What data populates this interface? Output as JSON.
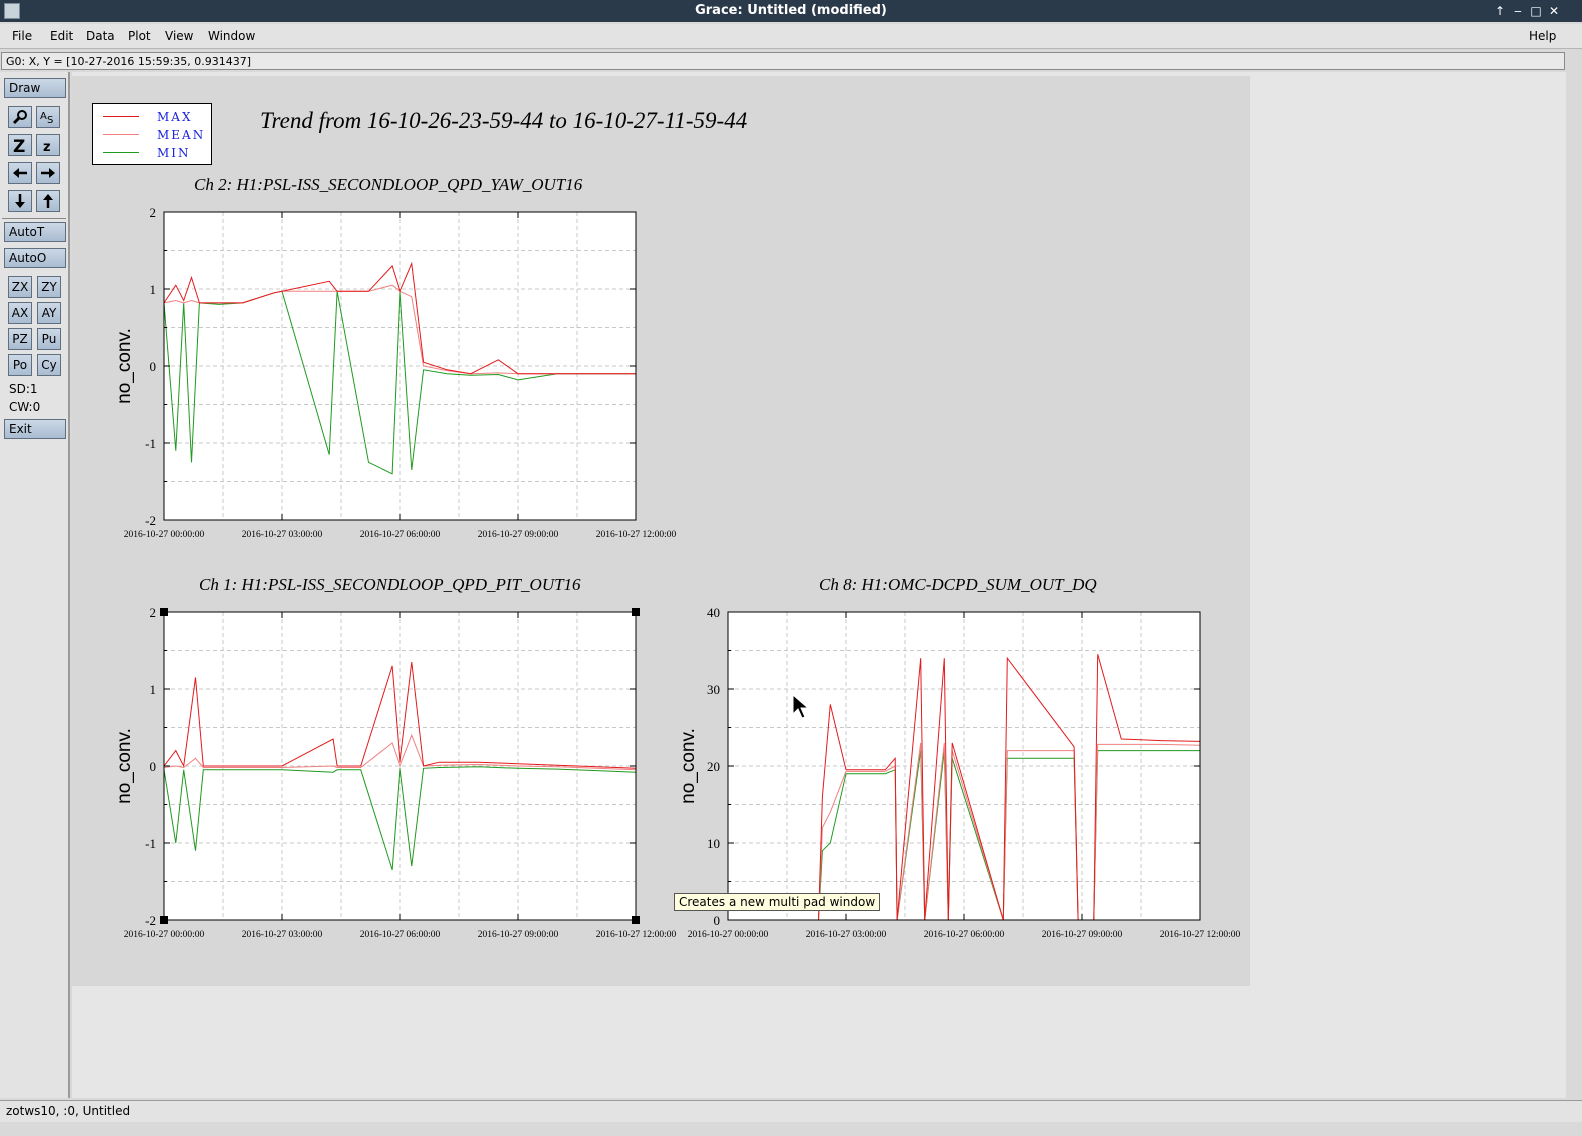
{
  "window": {
    "title": "Grace: Untitled (modified)"
  },
  "menu": {
    "items": [
      "File",
      "Edit",
      "Data",
      "Plot",
      "View",
      "Window"
    ],
    "help": "Help"
  },
  "locator": "G0: X, Y = [10-27-2016 15:59:35, 0.931437]",
  "toolbar": {
    "draw": "Draw",
    "autot": "AutoT",
    "autoo": "AutoO",
    "zx": "ZX",
    "zy": "ZY",
    "ax": "AX",
    "ay": "AY",
    "pz": "PZ",
    "pu": "Pu",
    "po": "Po",
    "cy": "Cy",
    "sd": "SD:1",
    "cw": "CW:0",
    "exit": "Exit"
  },
  "status": "zotws10, :0, Untitled",
  "tooltip": "Creates a new multi pad window",
  "legend": [
    {
      "label": "MAX",
      "color": "#e31a1c"
    },
    {
      "label": "MEAN",
      "color": "#f08080"
    },
    {
      "label": "MIN",
      "color": "#1f9a1f"
    }
  ],
  "plot_title": "Trend from 16-10-26-23-59-44 to 16-10-27-11-59-44",
  "chart_data": [
    {
      "type": "line",
      "title": "Ch 2: H1:PSL-ISS_SECONDLOOP_QPD_YAW_OUT16",
      "ylabel": "no_conv.",
      "ylim": [
        -2,
        2
      ],
      "yticks": [
        "2",
        "1",
        "0",
        "-1",
        "-2"
      ],
      "xticks": [
        "2016-10-27 00:00:00",
        "2016-10-27 03:00:00",
        "2016-10-27 06:00:00",
        "2016-10-27 09:00:00",
        "2016-10-27 12:00:00"
      ],
      "grid": true,
      "x_hours": [
        0,
        0.3,
        0.5,
        0.7,
        0.9,
        1.4,
        2.0,
        2.8,
        3.0,
        4.2,
        4.4,
        5.2,
        5.8,
        6.0,
        6.3,
        6.6,
        7.2,
        7.8,
        8.5,
        9.0,
        10.0,
        11.0,
        12.0
      ],
      "series": [
        {
          "name": "MAX",
          "values": [
            0.82,
            1.05,
            0.85,
            1.15,
            0.82,
            0.82,
            0.82,
            0.95,
            0.97,
            1.1,
            0.97,
            0.97,
            1.3,
            0.97,
            1.33,
            0.05,
            -0.05,
            -0.1,
            0.08,
            -0.1,
            -0.1,
            -0.1,
            -0.1
          ]
        },
        {
          "name": "MEAN",
          "values": [
            0.82,
            0.85,
            0.82,
            0.85,
            0.82,
            0.82,
            0.82,
            0.95,
            0.97,
            0.97,
            0.97,
            0.97,
            1.05,
            0.97,
            0.9,
            0.0,
            -0.06,
            -0.1,
            -0.09,
            -0.1,
            -0.1,
            -0.1,
            -0.1
          ]
        },
        {
          "name": "MIN",
          "values": [
            0.82,
            -1.1,
            0.82,
            -1.25,
            0.82,
            0.8,
            0.82,
            0.95,
            0.97,
            -1.15,
            0.97,
            -1.25,
            -1.4,
            0.97,
            -1.35,
            -0.05,
            -0.1,
            -0.12,
            -0.11,
            -0.18,
            -0.1,
            -0.1,
            -0.1
          ]
        }
      ]
    },
    {
      "type": "line",
      "title": "Ch 1: H1:PSL-ISS_SECONDLOOP_QPD_PIT_OUT16",
      "ylabel": "no_conv.",
      "ylim": [
        -2,
        2
      ],
      "yticks": [
        "2",
        "1",
        "0",
        "-1",
        "-2"
      ],
      "xticks": [
        "2016-10-27 00:00:00",
        "2016-10-27 03:00:00",
        "2016-10-27 06:00:00",
        "2016-10-27 09:00:00",
        "2016-10-27 12:00:00"
      ],
      "grid": true,
      "x_hours": [
        0,
        0.3,
        0.5,
        0.8,
        1.0,
        2.0,
        3.0,
        4.3,
        4.4,
        5.0,
        5.8,
        6.0,
        6.3,
        6.6,
        7.0,
        8.0,
        9.0,
        10.0,
        11.0,
        12.0
      ],
      "series": [
        {
          "name": "MAX",
          "values": [
            0.0,
            0.2,
            0.0,
            1.15,
            0.0,
            0.0,
            0.0,
            0.35,
            0.0,
            0.0,
            1.3,
            0.05,
            1.35,
            0.0,
            0.05,
            0.05,
            0.03,
            0.01,
            -0.01,
            -0.03
          ]
        },
        {
          "name": "MEAN",
          "values": [
            -0.02,
            0.0,
            -0.02,
            0.1,
            -0.02,
            -0.02,
            -0.02,
            0.0,
            -0.02,
            -0.02,
            0.3,
            0.0,
            0.4,
            0.0,
            0.01,
            0.02,
            0.0,
            -0.01,
            -0.03,
            -0.05
          ]
        },
        {
          "name": "MIN",
          "values": [
            -0.05,
            -1.0,
            -0.05,
            -1.1,
            -0.05,
            -0.05,
            -0.05,
            -0.08,
            -0.05,
            -0.05,
            -1.35,
            -0.03,
            -1.3,
            -0.03,
            -0.02,
            -0.01,
            -0.03,
            -0.04,
            -0.06,
            -0.08
          ]
        }
      ]
    },
    {
      "type": "line",
      "title": "Ch 8: H1:OMC-DCPD_SUM_OUT_DQ",
      "ylabel": "no_conv.",
      "ylim": [
        0,
        40
      ],
      "yticks": [
        "40",
        "30",
        "20",
        "10",
        "0"
      ],
      "xticks": [
        "2016-10-27 00:00:00",
        "2016-10-27 03:00:00",
        "2016-10-27 06:00:00",
        "2016-10-27 09:00:00",
        "2016-10-27 12:00:00"
      ],
      "grid": true,
      "x_hours": [
        0,
        0.8,
        1.2,
        2.3,
        2.4,
        2.6,
        3.0,
        4.0,
        4.25,
        4.3,
        4.9,
        5.0,
        5.5,
        5.6,
        5.7,
        7.0,
        7.1,
        8.8,
        8.9,
        9.3,
        9.4,
        10.0,
        11.0,
        12.0
      ],
      "series": [
        {
          "name": "MAX",
          "values": [
            0,
            0,
            0,
            0,
            16,
            28,
            19.5,
            19.5,
            21,
            0,
            34,
            0,
            34,
            0,
            23,
            0,
            34,
            22.5,
            0,
            0,
            34.5,
            23.5,
            23.3,
            23.2
          ]
        },
        {
          "name": "MEAN",
          "values": [
            0,
            0,
            0,
            0,
            12,
            14,
            19.3,
            19.3,
            20,
            0,
            23,
            0,
            23,
            0,
            22,
            0,
            22.0,
            22.0,
            0,
            0,
            22.8,
            22.8,
            22.8,
            22.7
          ]
        },
        {
          "name": "MIN",
          "values": [
            0,
            0,
            0,
            0,
            9,
            10,
            19.0,
            19.0,
            19.5,
            0,
            22,
            0,
            22,
            0,
            21,
            0,
            21.0,
            21.0,
            0,
            0,
            22.0,
            22.0,
            22.0,
            22.0
          ]
        }
      ]
    }
  ]
}
